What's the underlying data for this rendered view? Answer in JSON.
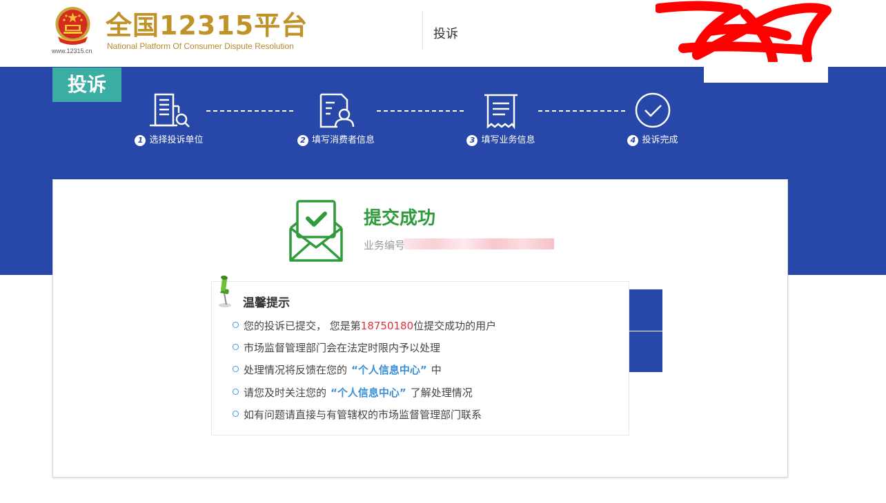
{
  "header": {
    "site_url": "www.12315.cn",
    "brand_cn": "全国12315平台",
    "brand_en": "National Platform Of Consumer Dispute Resolution",
    "nav_complaint": "投诉"
  },
  "band": {
    "tag": "投诉",
    "steps": [
      {
        "num": "1",
        "label": "选择投诉单位",
        "icon": "building-search-icon"
      },
      {
        "num": "2",
        "label": "填写消费者信息",
        "icon": "user-form-icon"
      },
      {
        "num": "3",
        "label": "填写业务信息",
        "icon": "receipt-icon"
      },
      {
        "num": "4",
        "label": "投诉完成",
        "icon": "check-circle-icon"
      }
    ]
  },
  "result": {
    "title": "提交成功",
    "biz_label": "业务编号"
  },
  "tips": {
    "title": "温馨提示",
    "line1_pre": "您的投诉已提交， 您是第",
    "line1_num": "18750180",
    "line1_post": "位提交成功的用户",
    "line2": "市场监督管理部门会在法定时限内予以处理",
    "line3_pre": "处理情况将反馈在您的",
    "line3_link": "“个人信息中心”",
    "line3_post": "中",
    "line4_pre": "请您及时关注您的",
    "line4_link": "“个人信息中心”",
    "line4_post": "了解处理情况",
    "line5": "如有问题请直接与有管辖权的市场监督管理部门联系"
  },
  "colors": {
    "brand_gold": "#c0932a",
    "band_blue": "#2748a9",
    "tag_teal": "#3aaea3",
    "success_green": "#2f9b3a",
    "link_blue": "#3a8fd6",
    "count_red": "#e0303a"
  }
}
